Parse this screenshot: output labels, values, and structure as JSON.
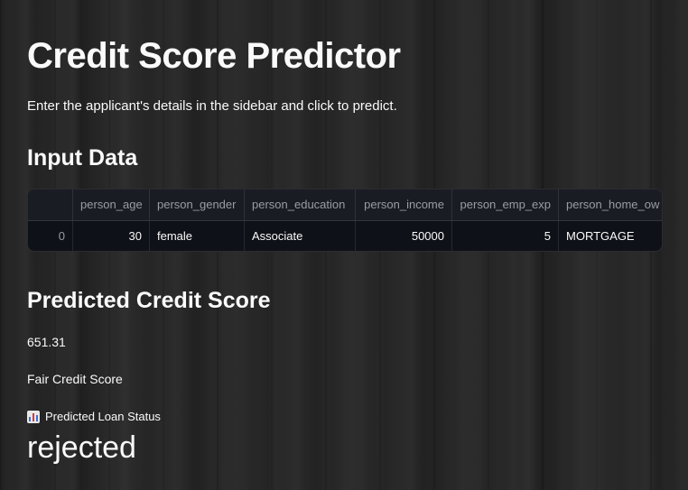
{
  "header": {
    "title": "Credit Score Predictor",
    "subtitle": "Enter the applicant's details in the sidebar and click to predict."
  },
  "input_section": {
    "heading": "Input Data",
    "table": {
      "columns": [
        "",
        "person_age",
        "person_gender",
        "person_education",
        "person_income",
        "person_emp_exp",
        "person_home_ow"
      ],
      "rows": [
        [
          "0",
          "30",
          "female",
          "Associate",
          "50000",
          "5",
          "MORTGAGE"
        ]
      ]
    }
  },
  "prediction": {
    "heading": "Predicted Credit Score",
    "score": "651.31",
    "category": "Fair Credit Score",
    "loan_status_icon": "bar-chart-icon",
    "loan_status_label": "Predicted Loan Status",
    "loan_status_value": "rejected"
  },
  "colors": {
    "text": "#fafafa",
    "table_background": "#0e1117",
    "header_text": "#9a9ca3"
  }
}
